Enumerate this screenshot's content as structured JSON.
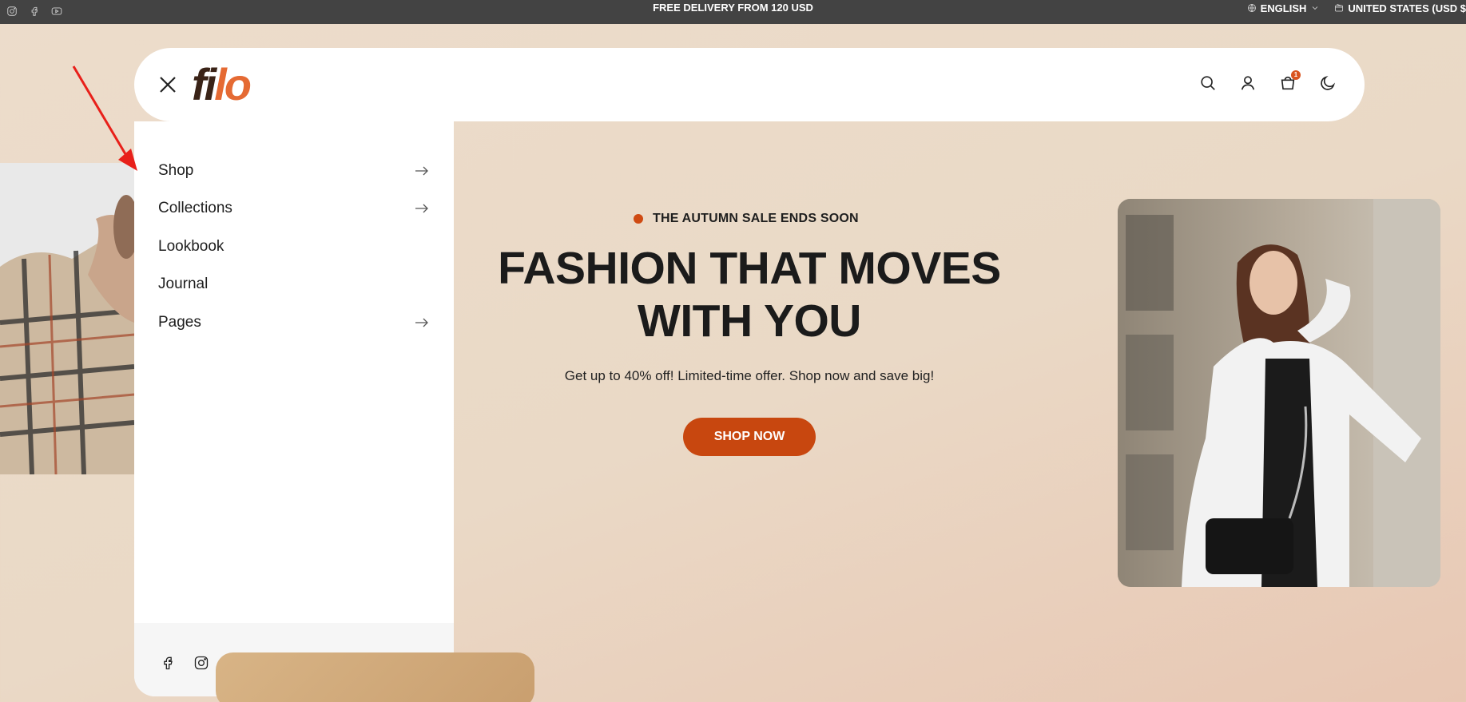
{
  "topbar": {
    "promo": "FREE DELIVERY FROM 120 USD",
    "language": "ENGLISH",
    "currency": "UNITED STATES (USD $",
    "social_icons": [
      "instagram-icon",
      "facebook-icon",
      "youtube-icon"
    ]
  },
  "header": {
    "logo_dark": "fi",
    "logo_accent": "lo",
    "cart_count": "1",
    "icons": [
      "search-icon",
      "user-icon",
      "cart-icon",
      "moon-icon"
    ]
  },
  "menu": {
    "items": [
      {
        "label": "Shop",
        "has_submenu": true
      },
      {
        "label": "Collections",
        "has_submenu": true
      },
      {
        "label": "Lookbook",
        "has_submenu": false
      },
      {
        "label": "Journal",
        "has_submenu": false
      },
      {
        "label": "Pages",
        "has_submenu": true
      }
    ],
    "footer_social_icons": [
      "facebook-icon",
      "instagram-icon",
      "youtube-icon"
    ]
  },
  "hero": {
    "tag": "THE AUTUMN SALE ENDS SOON",
    "headline_line1": "FASHION THAT MOVES",
    "headline_line2": "WITH YOU",
    "subtext": "Get up to 40% off! Limited-time offer. Shop now and save big!",
    "cta": "SHOP NOW"
  },
  "colors": {
    "accent": "#c8470f",
    "logo_orange": "#e56a33",
    "logo_dark": "#3a2317",
    "topbar": "#434343",
    "annotation_arrow": "#e8201a"
  }
}
